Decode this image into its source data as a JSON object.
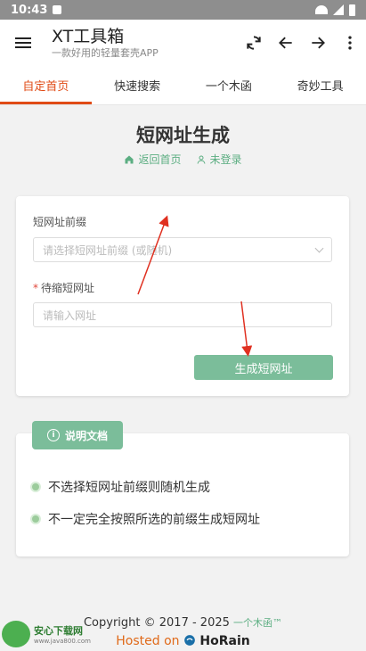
{
  "status_bar": {
    "time": "10:43"
  },
  "app_bar": {
    "title": "XT工具箱",
    "subtitle": "一款好用的轻量套壳APP",
    "icons": [
      "menu-icon",
      "refresh-icon",
      "arrow-left-icon",
      "arrow-right-icon",
      "more-vert-icon"
    ]
  },
  "tabs": [
    {
      "label": "自定首页",
      "active": true
    },
    {
      "label": "快速搜索",
      "active": false
    },
    {
      "label": "一个木函",
      "active": false
    },
    {
      "label": "奇妙工具",
      "active": false
    }
  ],
  "page": {
    "title": "短网址生成",
    "nav_home": "返回首页",
    "nav_login": "未登录"
  },
  "form": {
    "prefix_label": "短网址前缀",
    "prefix_placeholder": "请选择短网址前缀 (或随机)",
    "url_required_mark": "*",
    "url_label": "待缩短网址",
    "url_placeholder": "请输入网址",
    "submit_label": "生成短网址"
  },
  "docs": {
    "badge_label": "说明文档",
    "items": [
      "不选择短网址前缀则随机生成",
      "不一定完全按照所选的前缀生成短网址"
    ]
  },
  "footer": {
    "copyright": "Copyright © 2017 - 2025",
    "brand": "一个木函™",
    "hosted_prefix": "Hosted on",
    "host_name": "HoRain"
  },
  "watermark": {
    "line1": "安心下载网",
    "line2": "www.java800.com"
  },
  "colors": {
    "accent": "#e04b16",
    "green": "#7bbd9a",
    "green_text": "#5cae82",
    "annotation_arrow": "#e03020"
  }
}
